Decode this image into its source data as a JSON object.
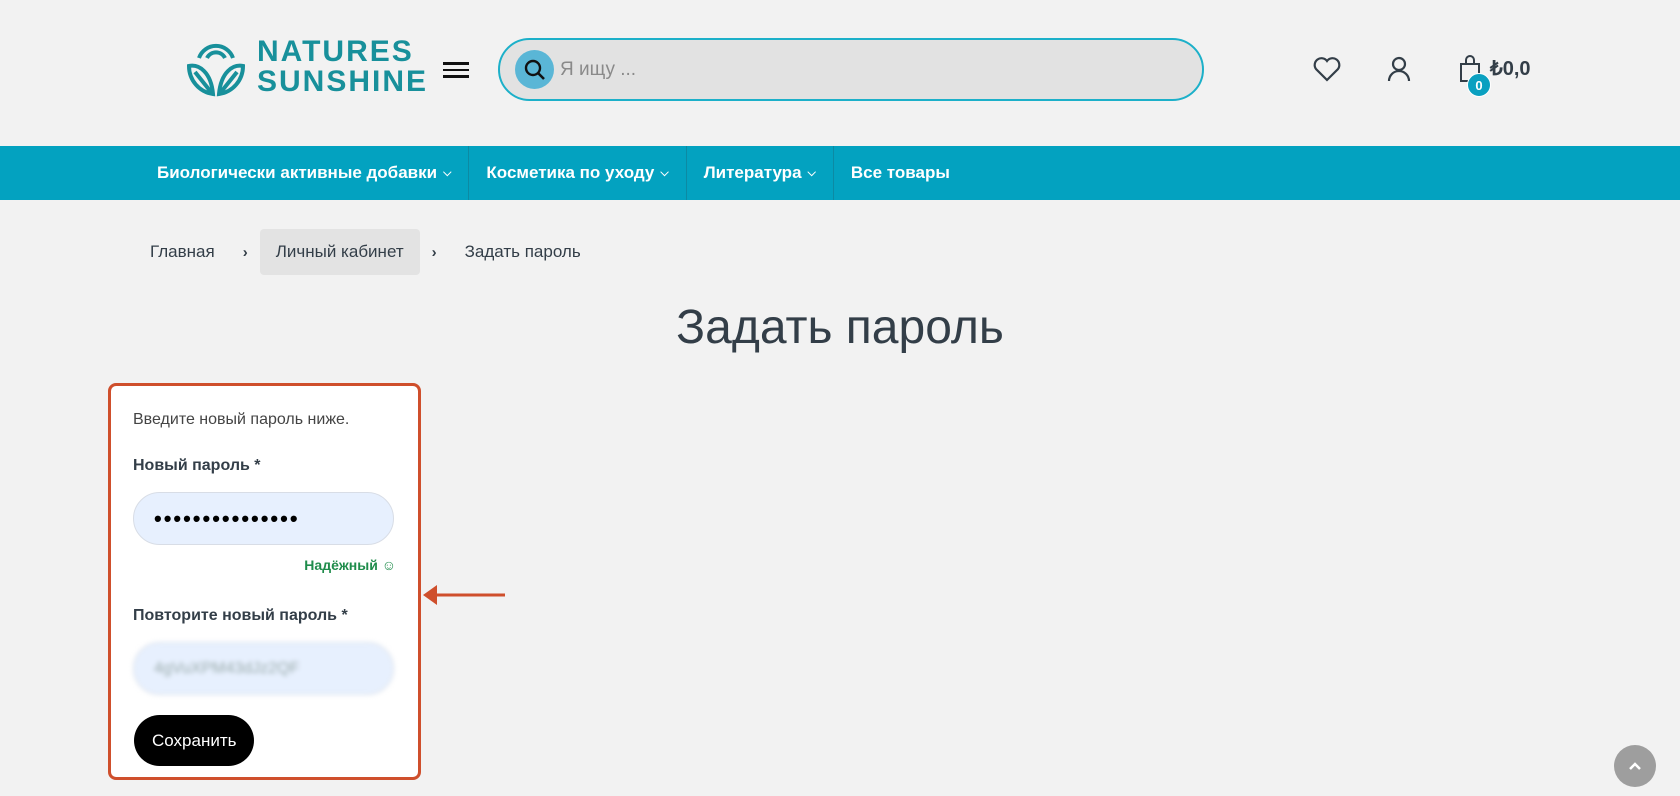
{
  "header": {
    "logo_line1": "NATURES",
    "logo_line2": "SUNSHINE",
    "search_placeholder": "Я ищу ...",
    "cart_count": "0",
    "cart_total": "₺0,0"
  },
  "nav": [
    {
      "label": "Биологически активные добавки",
      "has_dropdown": true
    },
    {
      "label": "Косметика по уходу",
      "has_dropdown": true
    },
    {
      "label": "Литература",
      "has_dropdown": true
    },
    {
      "label": "Все товары",
      "has_dropdown": false
    }
  ],
  "breadcrumb": [
    "Главная",
    "Личный кабинет",
    "Задать пароль"
  ],
  "page_title": "Задать пароль",
  "form": {
    "intro": "Введите новый пароль ниже.",
    "new_password_label": "Новый пароль *",
    "new_password_value": "•••••••••••••••",
    "strength": "Надёжный",
    "repeat_label": "Повторите новый пароль *",
    "repeat_value": "4gVuXPM43dJz2QF",
    "save_label": "Сохранить"
  },
  "colors": {
    "brand": "#18909b",
    "nav": "#03a2c0",
    "highlight": "#cf4f2c",
    "strength": "#1f8c4b"
  }
}
